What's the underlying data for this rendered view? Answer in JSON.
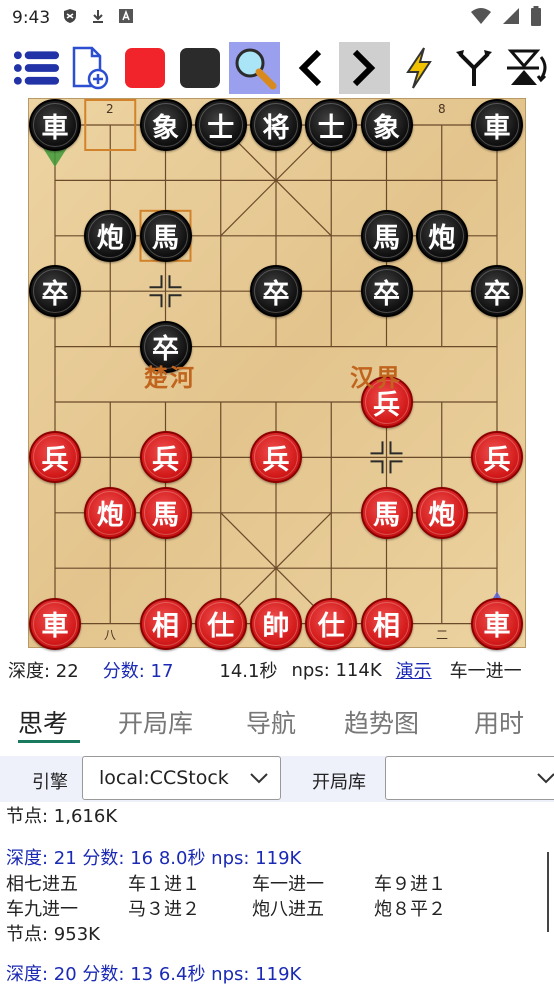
{
  "status_bar": {
    "time": "9:43",
    "icons": [
      "shield-icon",
      "download-icon",
      "a-box-icon"
    ],
    "right_icons": [
      "wifi-icon",
      "cell-signal-icon",
      "battery-icon"
    ]
  },
  "toolbar": {
    "items": [
      {
        "name": "menu-icon",
        "active": false
      },
      {
        "name": "new-file-icon",
        "active": false
      },
      {
        "name": "red-square-icon",
        "active": false
      },
      {
        "name": "black-square-icon",
        "active": false
      },
      {
        "name": "magnifier-icon",
        "active": true
      },
      {
        "name": "chevron-left-icon",
        "active": false
      },
      {
        "name": "chevron-right-icon",
        "active": false
      },
      {
        "name": "lightning-icon",
        "active": false
      },
      {
        "name": "fork-icon",
        "active": false
      },
      {
        "name": "flip-icon",
        "active": false
      }
    ],
    "colors": {
      "red": "#f0242a",
      "black": "#2b2b2b",
      "active_bg": "#9aa0ee"
    }
  },
  "board": {
    "file_labels_top": [
      "2",
      "8"
    ],
    "file_labels_bottom": [
      "八",
      "二"
    ],
    "river_left": "楚河",
    "river_right": "汉界",
    "pieces": [
      {
        "char": "車",
        "side": "black",
        "file": 0,
        "rank": 0
      },
      {
        "char": "象",
        "side": "black",
        "file": 2,
        "rank": 0
      },
      {
        "char": "士",
        "side": "black",
        "file": 3,
        "rank": 0
      },
      {
        "char": "将",
        "side": "black",
        "file": 4,
        "rank": 0
      },
      {
        "char": "士",
        "side": "black",
        "file": 5,
        "rank": 0
      },
      {
        "char": "象",
        "side": "black",
        "file": 6,
        "rank": 0
      },
      {
        "char": "車",
        "side": "black",
        "file": 8,
        "rank": 0
      },
      {
        "char": "炮",
        "side": "black",
        "file": 1,
        "rank": 2
      },
      {
        "char": "馬",
        "side": "black",
        "file": 2,
        "rank": 2
      },
      {
        "char": "馬",
        "side": "black",
        "file": 6,
        "rank": 2
      },
      {
        "char": "炮",
        "side": "black",
        "file": 7,
        "rank": 2
      },
      {
        "char": "卒",
        "side": "black",
        "file": 0,
        "rank": 3
      },
      {
        "char": "卒",
        "side": "black",
        "file": 4,
        "rank": 3
      },
      {
        "char": "卒",
        "side": "black",
        "file": 6,
        "rank": 3
      },
      {
        "char": "卒",
        "side": "black",
        "file": 8,
        "rank": 3
      },
      {
        "char": "卒",
        "side": "black",
        "file": 2,
        "rank": 4
      },
      {
        "char": "兵",
        "side": "red",
        "file": 6,
        "rank": 5
      },
      {
        "char": "兵",
        "side": "red",
        "file": 0,
        "rank": 6
      },
      {
        "char": "兵",
        "side": "red",
        "file": 2,
        "rank": 6
      },
      {
        "char": "兵",
        "side": "red",
        "file": 4,
        "rank": 6
      },
      {
        "char": "兵",
        "side": "red",
        "file": 8,
        "rank": 6
      },
      {
        "char": "炮",
        "side": "red",
        "file": 1,
        "rank": 7
      },
      {
        "char": "馬",
        "side": "red",
        "file": 2,
        "rank": 7
      },
      {
        "char": "馬",
        "side": "red",
        "file": 6,
        "rank": 7
      },
      {
        "char": "炮",
        "side": "red",
        "file": 7,
        "rank": 7
      },
      {
        "char": "車",
        "side": "red",
        "file": 0,
        "rank": 9
      },
      {
        "char": "相",
        "side": "red",
        "file": 2,
        "rank": 9
      },
      {
        "char": "仕",
        "side": "red",
        "file": 3,
        "rank": 9
      },
      {
        "char": "帥",
        "side": "red",
        "file": 4,
        "rank": 9
      },
      {
        "char": "仕",
        "side": "red",
        "file": 5,
        "rank": 9
      },
      {
        "char": "相",
        "side": "red",
        "file": 6,
        "rank": 9
      },
      {
        "char": "車",
        "side": "red",
        "file": 8,
        "rank": 9
      }
    ],
    "colors": {
      "board": "#e8cd98",
      "line": "#6b4a2a",
      "highlight": "#d2822a",
      "river_text": "#c0641e",
      "arrow_green": "#3f9a3a",
      "arrow_blue": "#5560e0"
    }
  },
  "info": {
    "depth": "深度: 22",
    "score": "分数: 17",
    "time": "14.1秒",
    "nps": "nps: 114K",
    "demo_link": "演示",
    "best_move": "车一进一"
  },
  "tabs": [
    "思考",
    "开局库",
    "导航",
    "趋势图",
    "用时"
  ],
  "engine_row": {
    "engine_label": "引擎",
    "engine_value": "local:CCStock",
    "book_label": "开局库",
    "book_value": ""
  },
  "analysis": {
    "line0": "节点: 1,616K",
    "block1_header": "深度: 21  分数: 16  8.0秒  nps: 119K",
    "block1_moves": [
      "相七进五",
      "车１进１",
      "车一进一",
      "车９进１",
      "车九进一",
      "马３进２",
      "炮八进五",
      "炮８平２"
    ],
    "block1_nodes": "节点: 953K",
    "block2_header": "深度: 20  分数: 13  6.4秒  nps: 119K"
  }
}
